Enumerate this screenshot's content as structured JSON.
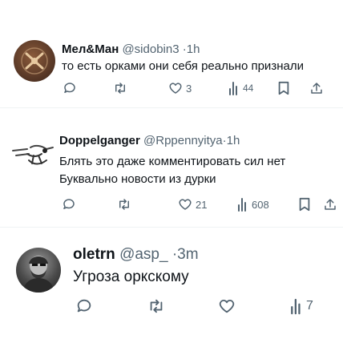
{
  "colors": {
    "text": "#0f1419",
    "secondary": "#536471",
    "divider": "#eff3f4",
    "background": "#ffffff"
  },
  "tweets": [
    {
      "name": "Мел&Ман",
      "handle": "@sidobin3",
      "separator": "·",
      "time": "1h",
      "lines": [
        "то есть орками они себя реально признали"
      ],
      "reply_count": "",
      "retweet_count": "",
      "like_count": "3",
      "view_count": "44",
      "icons": [
        "reply-icon",
        "retweet-icon",
        "like-icon",
        "views-icon",
        "bookmark-icon",
        "share-icon"
      ]
    },
    {
      "name": "Doppelganger",
      "handle": "@Rppennyitya",
      "separator": "·",
      "time": "1h",
      "lines": [
        "Блять это даже комментировать сил нет",
        "Буквально новости из дурки"
      ],
      "reply_count": "",
      "retweet_count": "",
      "like_count": "21",
      "view_count": "608",
      "icons": [
        "reply-icon",
        "retweet-icon",
        "like-icon",
        "views-icon",
        "bookmark-icon",
        "share-icon"
      ]
    },
    {
      "name": "oletrn",
      "handle": "@asp_",
      "separator": "·",
      "time": "3m",
      "lines": [
        "Угроза оркскому"
      ],
      "reply_count": "",
      "retweet_count": "",
      "like_count": "",
      "view_count": "7",
      "icons": [
        "reply-icon",
        "retweet-icon",
        "like-icon",
        "views-icon"
      ]
    }
  ]
}
